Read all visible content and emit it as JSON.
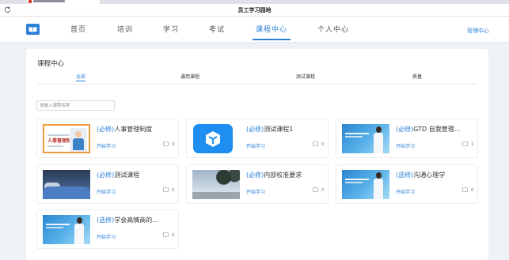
{
  "browser": {
    "window_title": "员工学习园地"
  },
  "nav": {
    "items": [
      "首页",
      "培训",
      "学习",
      "考试",
      "课程中心",
      "个人中心"
    ],
    "active_index": 4,
    "manage_label": "管理中心"
  },
  "panel": {
    "title": "课程中心",
    "tabs": [
      "全部",
      "通用课程",
      "测试课程",
      "质量"
    ],
    "active_tab": 0,
    "search_placeholder": "请输入课程名称"
  },
  "courses": [
    {
      "tag": "(必修)",
      "name": "人事管理制度",
      "action": "开始学习",
      "comments": "0",
      "thumb_text": "人事管理制度",
      "thumb": "hr-cover"
    },
    {
      "tag": "(必修)",
      "name": "测试课程1",
      "action": "开始学习",
      "comments": "0",
      "thumb": "cube-logo"
    },
    {
      "tag": "(必修)",
      "name": "GTD 自我管理...",
      "action": "开始学习",
      "comments": "1",
      "thumb": "presenter-blue"
    },
    {
      "tag": "(必修)",
      "name": "测试课程",
      "action": "开始学习",
      "comments": "0",
      "thumb": "sleeping-photo"
    },
    {
      "tag": "(必修)",
      "name": "内部校准要求",
      "action": "开始学习",
      "comments": "0",
      "thumb": "nature-photo"
    },
    {
      "tag": "(选修)",
      "name": "沟通心理学",
      "action": "开始学习",
      "comments": "0",
      "thumb": "presenter-blue"
    },
    {
      "tag": "(选修)",
      "name": "学会高情商的...",
      "action": "开始学习",
      "comments": "0",
      "thumb": "presenter-blue"
    }
  ],
  "colors": {
    "accent": "#2b7fd9",
    "background": "#eef1f6"
  }
}
